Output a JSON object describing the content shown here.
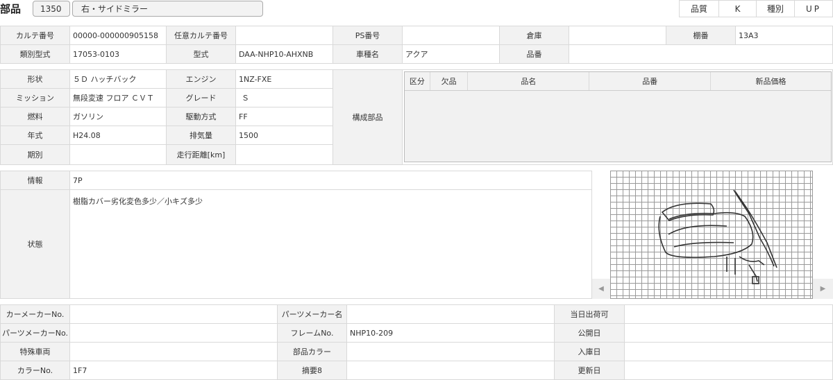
{
  "header": {
    "title": "部品",
    "part_code": "1350",
    "part_name": "右・サイドミラー",
    "quality_label": "品質",
    "quality_value": "K",
    "type_label": "種別",
    "type_value": "UP"
  },
  "karte": {
    "karte_no_label": "カルテ番号",
    "karte_no": "00000-000000905158",
    "any_karte_label": "任意カルテ番号",
    "any_karte": "",
    "ps_no_label": "PS番号",
    "ps_no": "",
    "warehouse_label": "倉庫",
    "warehouse": "",
    "shelf_label": "棚番",
    "shelf": "13A3",
    "class_model_label": "類別型式",
    "class_model": "17053-0103",
    "model_label": "型式",
    "model": "DAA-NHP10-AHXNB",
    "car_name_label": "車種名",
    "car_name": "アクア",
    "part_no_label": "品番",
    "part_no": ""
  },
  "vehicle": {
    "shape_label": "形状",
    "shape": "５Ｄ ハッチバック",
    "engine_label": "エンジン",
    "engine": "1NZ-FXE",
    "mission_label": "ミッション",
    "mission": "無段変速 フロア ＣＶＴ",
    "grade_label": "グレード",
    "grade": "Ｓ",
    "fuel_label": "燃料",
    "fuel": "ガソリン",
    "drive_label": "駆動方式",
    "drive": "FF",
    "year_label": "年式",
    "year": "H24.08",
    "displacement_label": "排気量",
    "displacement": "1500",
    "period_label": "期別",
    "period": "",
    "mileage_label": "走行距離[km]",
    "mileage": ""
  },
  "components": {
    "label": "構成部品",
    "columns": [
      "区分",
      "欠品",
      "品名",
      "品番",
      "新品価格"
    ]
  },
  "info": {
    "info_label": "情報",
    "info_value": "7P",
    "condition_label": "状態",
    "condition_value": "樹脂カバー劣化変色多少／小キズ多少"
  },
  "image_viewer": {
    "prev_icon": "◀",
    "next_icon": "▶"
  },
  "bottom": {
    "car_maker_no_label": "カーメーカーNo.",
    "car_maker_no": "",
    "parts_maker_name_label": "パーツメーカー名",
    "parts_maker_name": "",
    "same_day_label": "当日出荷可",
    "same_day": "",
    "parts_maker_no_label": "パーツメーカーNo.",
    "parts_maker_no": "",
    "frame_no_label": "フレームNo.",
    "frame_no": "NHP10-209",
    "publish_date_label": "公開日",
    "publish_date": "",
    "special_vehicle_label": "特殊車両",
    "special_vehicle": "",
    "part_color_label": "部品カラー",
    "part_color": "",
    "stock_date_label": "入庫日",
    "stock_date": "",
    "color_no_label": "カラーNo.",
    "color_no": "1F7",
    "summary_label": "摘要8",
    "summary": "",
    "update_date_label": "更新日",
    "update_date": ""
  }
}
